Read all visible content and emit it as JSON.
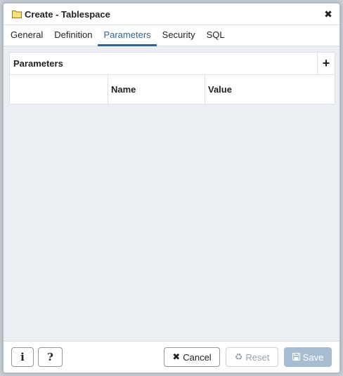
{
  "dialog": {
    "title": "Create - Tablespace",
    "icons": {
      "title": "folder-icon",
      "close": "close-icon"
    }
  },
  "tabs": [
    {
      "label": "General",
      "active": false
    },
    {
      "label": "Definition",
      "active": false
    },
    {
      "label": "Parameters",
      "active": true
    },
    {
      "label": "Security",
      "active": false
    },
    {
      "label": "SQL",
      "active": false
    }
  ],
  "parameters": {
    "section_label": "Parameters",
    "add_icon": "+",
    "columns": [
      "",
      "Name",
      "Value"
    ]
  },
  "footer": {
    "info_icon": "i",
    "help_icon": "?",
    "cancel_label": "Cancel",
    "reset_label": "Reset",
    "save_label": "Save"
  },
  "colors": {
    "accent": "#326690",
    "save_disabled": "#a7bdd2",
    "content_bg": "#ebeef3"
  }
}
